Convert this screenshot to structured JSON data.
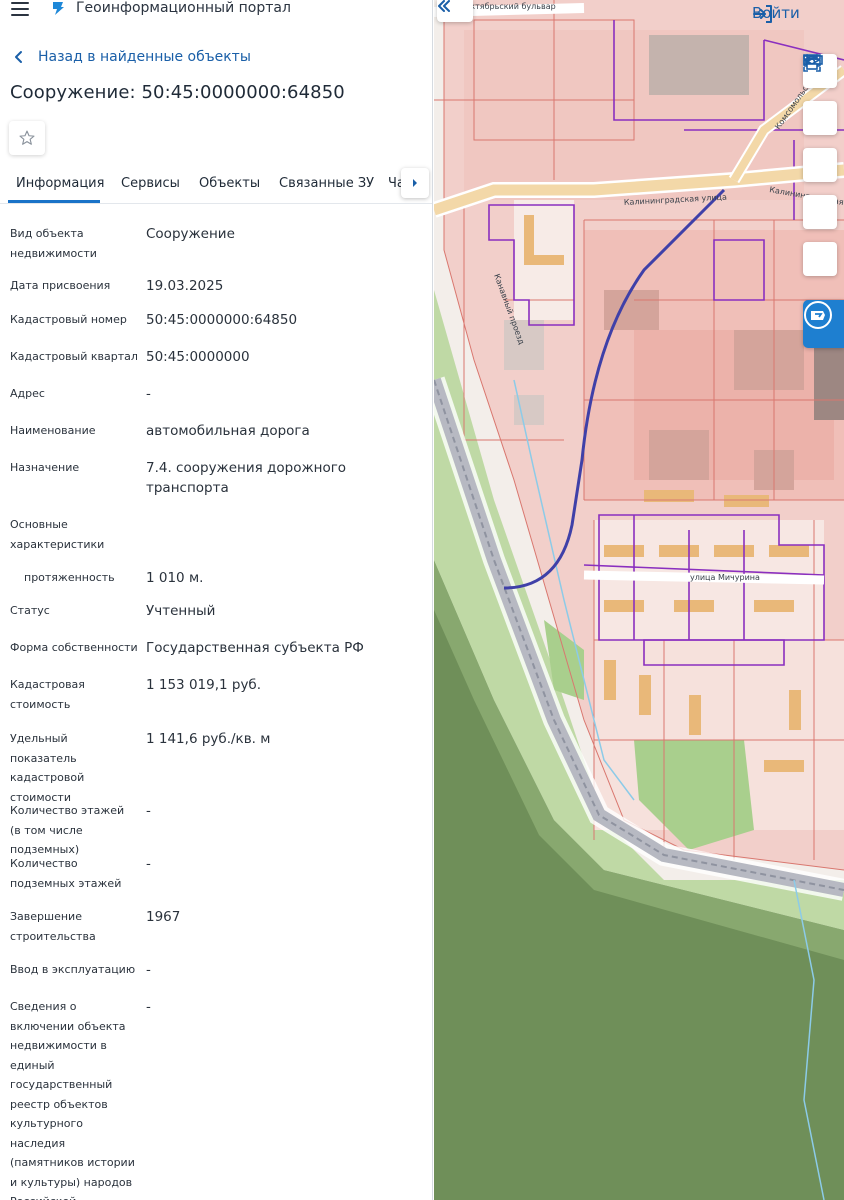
{
  "app": {
    "title": "Геоинформационный портал"
  },
  "nav": {
    "back_label": "Назад в найденные объекты"
  },
  "object": {
    "title": "Сооружение: 50:45:0000000:64850"
  },
  "tabs": [
    {
      "label": "Информация"
    },
    {
      "label": "Сервисы"
    },
    {
      "label": "Объекты"
    },
    {
      "label": "Связанные ЗУ"
    },
    {
      "label": "Части"
    }
  ],
  "fields": [
    {
      "label": "Вид объекта недвижимости",
      "value": "Сооружение"
    },
    {
      "label": "Дата присвоения",
      "value": "19.03.2025"
    },
    {
      "label": "Кадастровый номер",
      "value": "50:45:0000000:64850"
    },
    {
      "label": "Кадастровый квартал",
      "value": "50:45:0000000"
    },
    {
      "label": "Адрес",
      "value": "-"
    },
    {
      "label": "Наименование",
      "value": "автомобильная дорога"
    },
    {
      "label": "Назначение",
      "value": "7.4. сооружения дорожного транспорта"
    },
    {
      "label": "Основные характеристики",
      "value": ""
    },
    {
      "label": "протяженность",
      "value": "1 010 м."
    },
    {
      "label": "Статус",
      "value": "Учтенный"
    },
    {
      "label": "Форма собственности",
      "value": "Государственная субъекта РФ"
    },
    {
      "label": "Кадастровая стоимость",
      "value": "1 153 019,1 руб."
    },
    {
      "label": "Удельный показатель кадастровой стоимости",
      "value": "1 141,6 руб./кв. м"
    },
    {
      "label": "Количество этажей (в том числе подземных)",
      "value": "-"
    },
    {
      "label": "Количество подземных этажей",
      "value": "-"
    },
    {
      "label": "Завершение строительства",
      "value": "1967"
    },
    {
      "label": "Ввод в эксплуатацию",
      "value": "-"
    },
    {
      "label": "Сведения о включении объекта недвижимости в единый государственный реестр объектов культурного наследия (памятников истории и культуры) народов Российской Федерации",
      "value": "-"
    }
  ],
  "map": {
    "login_label": "Войти",
    "street_labels": [
      {
        "text": "Октябрьский бульвар"
      },
      {
        "text": "Калининградская улица"
      },
      {
        "text": "Калининградская"
      },
      {
        "text": "Канавный проезд"
      },
      {
        "text": "улица Мичурина"
      },
      {
        "text": "Комсомольская"
      }
    ],
    "tools": [
      "layers-icon",
      "ruler-icon",
      "select-area-icon",
      "share-icon",
      "print-icon",
      "cadastral-panel-icon"
    ]
  },
  "colors": {
    "accent": "#1a73c8",
    "link": "#1a5fa8",
    "forest": "#6e8e58",
    "parcel_fill": "#f2c9c4",
    "parcel_stroke": "#d9776f",
    "boundary": "#8a2fbf",
    "route": "#3f40a8"
  }
}
